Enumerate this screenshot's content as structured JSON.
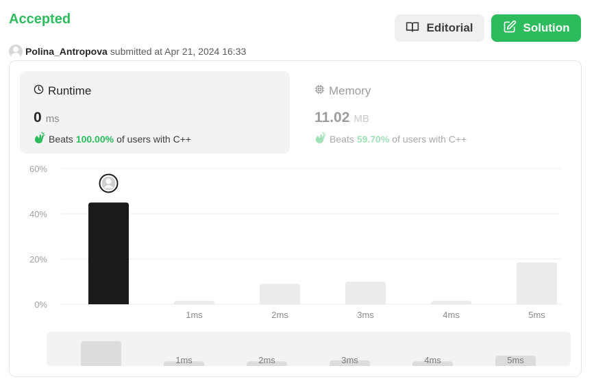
{
  "header": {
    "status": "Accepted",
    "username": "Polina_Antropova",
    "submitted_text": "submitted at Apr 21, 2024 16:33",
    "editorial_label": "Editorial",
    "solution_label": "Solution"
  },
  "runtime": {
    "title": "Runtime",
    "value": "0",
    "unit": "ms",
    "beats_prefix": "Beats",
    "beats_pct": "100.00%",
    "beats_suffix": "of users with C++",
    "icon": "clock-icon"
  },
  "memory": {
    "title": "Memory",
    "value": "11.02",
    "unit": "MB",
    "beats_prefix": "Beats",
    "beats_pct": "59.70%",
    "beats_suffix": "of users with C++",
    "icon": "chip-icon"
  },
  "colors": {
    "accent": "#2cbb5d",
    "bar_active": "#1a1a1a",
    "bar_inactive": "#ebebeb",
    "mini_bar": "#dcdcdc"
  },
  "chart_data": {
    "type": "bar",
    "categories": [
      "",
      "1ms",
      "2ms",
      "3ms",
      "4ms",
      "5ms"
    ],
    "values": [
      45,
      1.5,
      9,
      10,
      1.5,
      18.5
    ],
    "highlight_index": 0,
    "ylim": [
      0,
      60
    ],
    "yticks": [
      "0%",
      "20%",
      "40%",
      "60%"
    ],
    "ytick_values": [
      0,
      20,
      40,
      60
    ],
    "grid": true,
    "mini_values": [
      11,
      2,
      2,
      2.5,
      2,
      4.5
    ],
    "mini_labels": [
      "",
      "1ms",
      "2ms",
      "3ms",
      "4ms",
      "5ms"
    ]
  }
}
